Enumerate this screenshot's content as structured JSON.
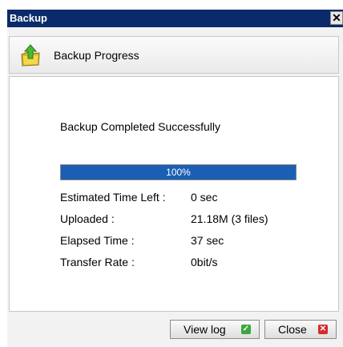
{
  "window": {
    "title": "Backup",
    "close_glyph": "✕"
  },
  "header": {
    "title": "Backup Progress",
    "icon": "folder-upload-icon"
  },
  "status": {
    "message": "Backup Completed Successfully"
  },
  "progress": {
    "percent": 100,
    "label": "100%",
    "color": "#1a5fb4"
  },
  "info": {
    "estimated_label": "Estimated Time Left :",
    "estimated_value": "0 sec",
    "uploaded_label": "Uploaded :",
    "uploaded_value": "21.18M (3 files)",
    "elapsed_label": "Elapsed Time :",
    "elapsed_value": "37 sec",
    "rate_label": "Transfer Rate :",
    "rate_value": "0bit/s"
  },
  "buttons": {
    "view_log": "View log",
    "close": "Close"
  },
  "colors": {
    "titlebar": "#0a2a6a"
  }
}
